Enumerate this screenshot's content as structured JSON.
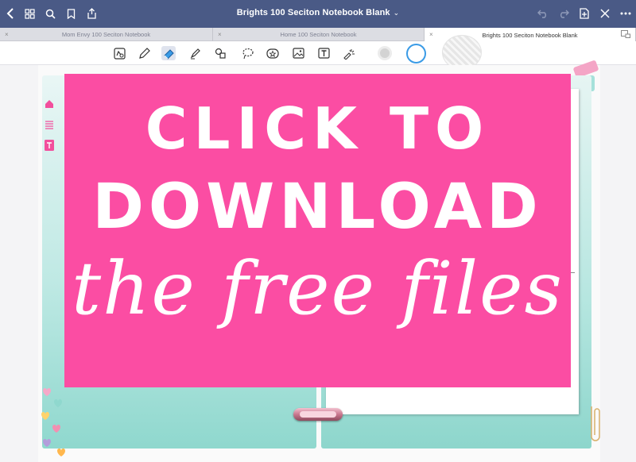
{
  "topbar": {
    "title": "Brights 100 Seciton Notebook Blank",
    "title_chevron": "⌄",
    "icons": [
      "back-icon",
      "grid-icon",
      "search-icon",
      "bookmark-icon",
      "share-icon",
      "undo-icon",
      "redo-icon",
      "add-page-icon",
      "close-icon",
      "more-icon"
    ]
  },
  "tabs": [
    {
      "label": "Mom Envy 100 Seciton Notebook",
      "close": "×"
    },
    {
      "label": "Home 100 Seciton Notebook",
      "close": "×"
    },
    {
      "label": "Brights 100 Seciton Notebook Blank",
      "close": "×",
      "active": true
    }
  ],
  "tools": [
    "lasso-readonly-icon",
    "pen-icon",
    "eraser-icon",
    "highlighter-icon",
    "shapes-icon",
    "lasso-icon",
    "sticker-icon",
    "image-icon",
    "text-icon",
    "laser-pointer-icon"
  ],
  "colors": {
    "accent": "#4a5a86",
    "banner": "#fb4da3",
    "swatch_gray": "#c8c8c8",
    "swatch_blue": "#3a9be6"
  },
  "banner": {
    "line1": "CLICK TO",
    "line2": "DOWNLOAD",
    "line3": "the free files"
  }
}
